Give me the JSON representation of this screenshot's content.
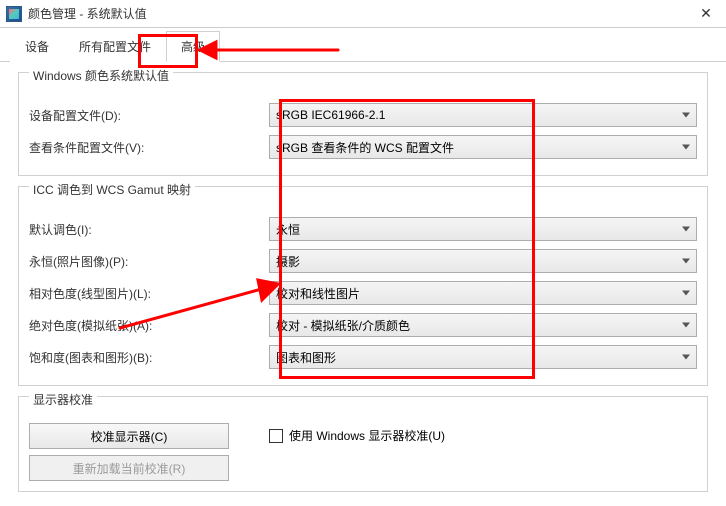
{
  "window": {
    "title": "颜色管理 - 系统默认值"
  },
  "tabs": {
    "device": "设备",
    "all_profiles": "所有配置文件",
    "advanced": "高级"
  },
  "group1": {
    "title": "Windows 颜色系统默认值",
    "device_profile_label": "设备配置文件(D):",
    "device_profile_value": "sRGB IEC61966-2.1",
    "viewing_label": "查看条件配置文件(V):",
    "viewing_value": "sRGB 查看条件的 WCS 配置文件"
  },
  "group2": {
    "title": "ICC 调色到 WCS Gamut 映射",
    "default_intent_label": "默认调色(I):",
    "default_intent_value": "永恒",
    "perceptual_label": "永恒(照片图像)(P):",
    "perceptual_value": "摄影",
    "relative_label": "相对色度(线型图片)(L):",
    "relative_value": "校对和线性图片",
    "absolute_label": "绝对色度(模拟纸张)(A):",
    "absolute_value": "校对 - 模拟纸张/介质颜色",
    "saturation_label": "饱和度(图表和图形)(B):",
    "saturation_value": "图表和图形"
  },
  "group3": {
    "title": "显示器校准",
    "calibrate_btn": "校准显示器(C)",
    "reload_btn": "重新加载当前校准(R)",
    "use_wcs_label": "使用 Windows 显示器校准(U)"
  },
  "annotation": {
    "highlight_tab": "高级",
    "highlight_combos": true
  }
}
